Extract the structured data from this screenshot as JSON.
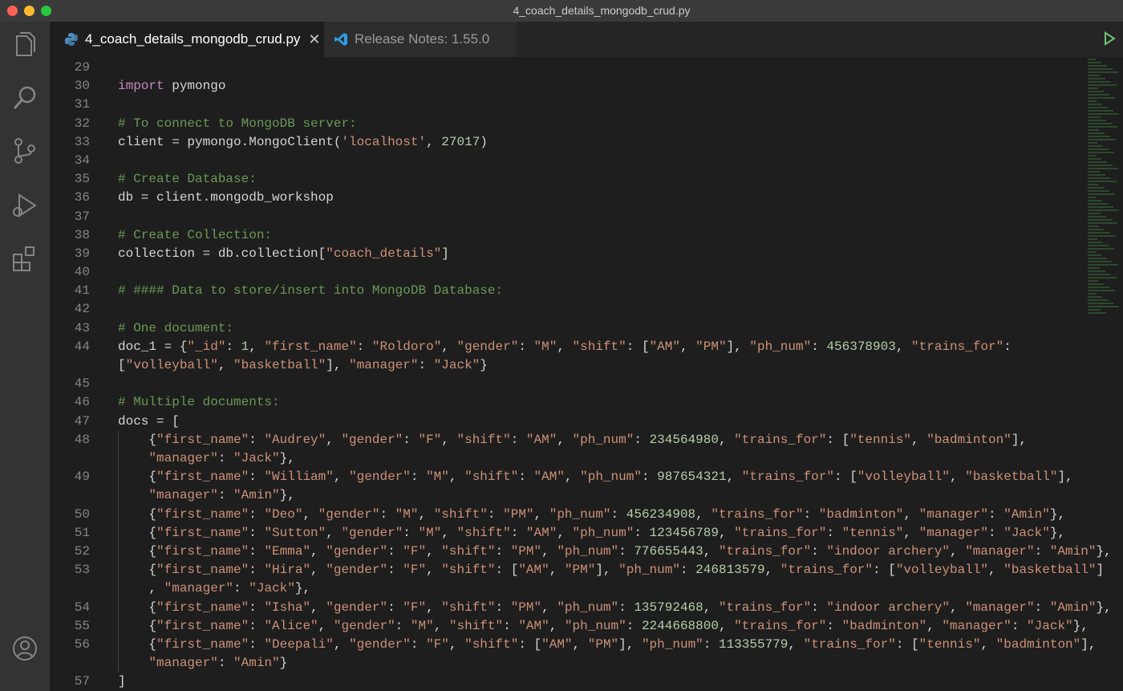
{
  "window": {
    "title": "4_coach_details_mongodb_crud.py"
  },
  "tabs": [
    {
      "label": "4_coach_details_mongodb_crud.py",
      "icon": "python-icon",
      "active": true
    },
    {
      "label": "Release Notes: 1.55.0",
      "icon": "vscode-icon",
      "active": false
    }
  ],
  "activity_bar": [
    "explorer-icon",
    "search-icon",
    "source-control-icon",
    "run-debug-icon",
    "extensions-icon",
    "account-icon"
  ],
  "colors": {
    "keyword": "#c586c0",
    "comment": "#6a9955",
    "string": "#ce9178",
    "number": "#b5cea8",
    "text": "#d4d4d4"
  },
  "code": {
    "lines": [
      {
        "n": "29",
        "text": ""
      },
      {
        "n": "30",
        "text": "import pymongo"
      },
      {
        "n": "31",
        "text": ""
      },
      {
        "n": "32",
        "text": "# To connect to MongoDB server:"
      },
      {
        "n": "33",
        "text": "client = pymongo.MongoClient('localhost', 27017)"
      },
      {
        "n": "34",
        "text": ""
      },
      {
        "n": "35",
        "text": "# Create Database:"
      },
      {
        "n": "36",
        "text": "db = client.mongodb_workshop"
      },
      {
        "n": "37",
        "text": ""
      },
      {
        "n": "38",
        "text": "# Create Collection:"
      },
      {
        "n": "39",
        "text": "collection = db.collection[\"coach_details\"]"
      },
      {
        "n": "40",
        "text": ""
      },
      {
        "n": "41",
        "text": "# #### Data to store/insert into MongoDB Database:"
      },
      {
        "n": "42",
        "text": ""
      },
      {
        "n": "43",
        "text": "# One document:"
      },
      {
        "n": "44",
        "text": "doc_1 = {\"_id\": 1, \"first_name\": \"Roldoro\", \"gender\": \"M\", \"shift\": [\"AM\", \"PM\"], \"ph_num\": 456378903, \"trains_for\":\n[\"volleyball\", \"basketball\"], \"manager\": \"Jack\"}"
      },
      {
        "n": "45",
        "text": ""
      },
      {
        "n": "46",
        "text": "# Multiple documents:"
      },
      {
        "n": "47",
        "text": "docs = ["
      },
      {
        "n": "48",
        "text": "    {\"first_name\": \"Audrey\", \"gender\": \"F\", \"shift\": \"AM\", \"ph_num\": 234564980, \"trains_for\": [\"tennis\", \"badminton\"],\n    \"manager\": \"Jack\"},"
      },
      {
        "n": "49",
        "text": "    {\"first_name\": \"William\", \"gender\": \"M\", \"shift\": \"AM\", \"ph_num\": 987654321, \"trains_for\": [\"volleyball\", \"basketball\"],\n    \"manager\": \"Amin\"},"
      },
      {
        "n": "50",
        "text": "    {\"first_name\": \"Deo\", \"gender\": \"M\", \"shift\": \"PM\", \"ph_num\": 456234908, \"trains_for\": \"badminton\", \"manager\": \"Amin\"},"
      },
      {
        "n": "51",
        "text": "    {\"first_name\": \"Sutton\", \"gender\": \"M\", \"shift\": \"AM\", \"ph_num\": 123456789, \"trains_for\": \"tennis\", \"manager\": \"Jack\"},"
      },
      {
        "n": "52",
        "text": "    {\"first_name\": \"Emma\", \"gender\": \"F\", \"shift\": \"PM\", \"ph_num\": 776655443, \"trains_for\": \"indoor archery\", \"manager\": \"Amin\"},"
      },
      {
        "n": "53",
        "text": "    {\"first_name\": \"Hira\", \"gender\": \"F\", \"shift\": [\"AM\", \"PM\"], \"ph_num\": 246813579, \"trains_for\": [\"volleyball\", \"basketball\"]\n    , \"manager\": \"Jack\"},"
      },
      {
        "n": "54",
        "text": "    {\"first_name\": \"Isha\", \"gender\": \"F\", \"shift\": \"PM\", \"ph_num\": 135792468, \"trains_for\": \"indoor archery\", \"manager\": \"Amin\"},"
      },
      {
        "n": "55",
        "text": "    {\"first_name\": \"Alice\", \"gender\": \"M\", \"shift\": \"AM\", \"ph_num\": 2244668800, \"trains_for\": \"badminton\", \"manager\": \"Jack\"},"
      },
      {
        "n": "56",
        "text": "    {\"first_name\": \"Deepali\", \"gender\": \"F\", \"shift\": [\"AM\", \"PM\"], \"ph_num\": 113355779, \"trains_for\": [\"tennis\", \"badminton\"],\n    \"manager\": \"Amin\"}"
      },
      {
        "n": "57",
        "text": "]"
      }
    ]
  }
}
